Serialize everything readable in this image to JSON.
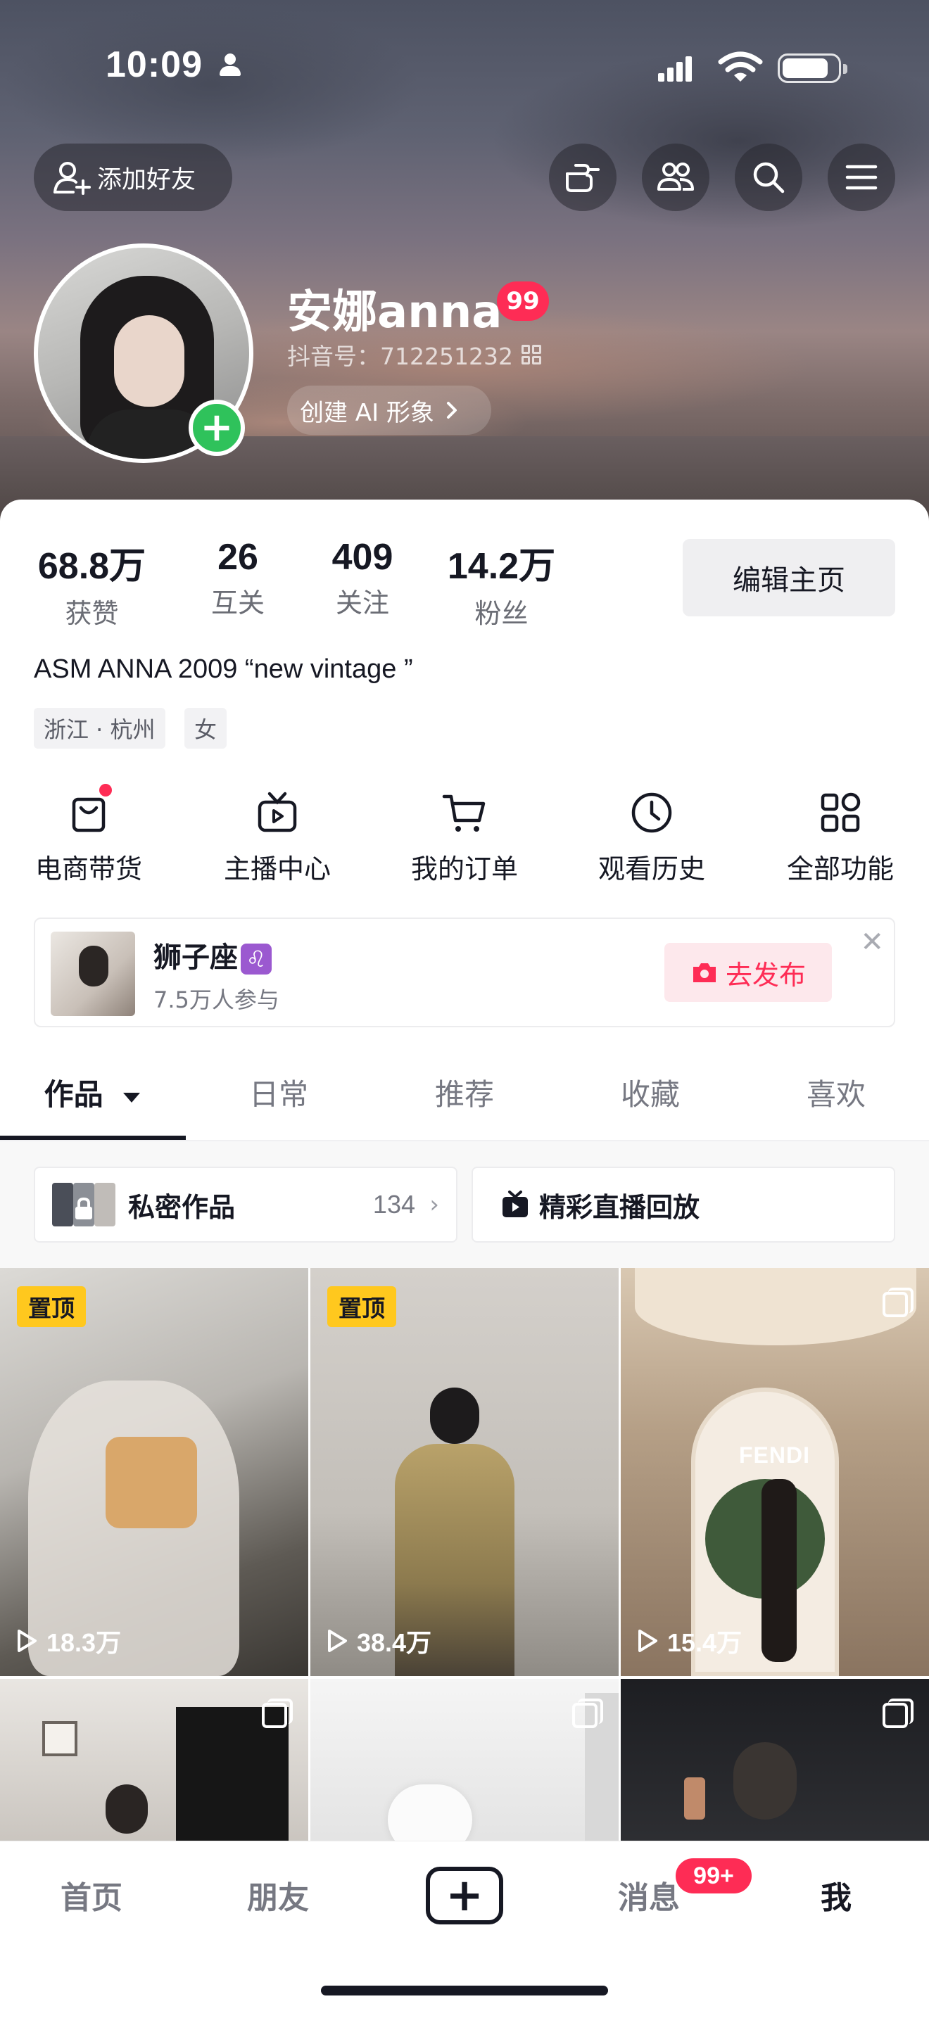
{
  "status_bar": {
    "time": "10:09"
  },
  "header": {
    "add_friend_label": "添加好友",
    "icons": [
      "poke-icon",
      "friends-icon",
      "search-icon",
      "menu-icon"
    ]
  },
  "profile": {
    "name": "安娜anna",
    "name_badge": "99",
    "douyin_id": "抖音号：712251232",
    "ai_button": "创建 AI 形象",
    "stats": [
      {
        "value": "68.8万",
        "label": "获赞"
      },
      {
        "value": "26",
        "label": "互关"
      },
      {
        "value": "409",
        "label": "关注"
      },
      {
        "value": "14.2万",
        "label": "粉丝"
      }
    ],
    "edit_button": "编辑主页",
    "bio": "ASM ANNA 2009 “new vintage ”",
    "tags": [
      "浙江 · 杭州",
      "女"
    ]
  },
  "functions": [
    {
      "label": "电商带货",
      "icon": "shopping-bag-icon",
      "has_dot": true
    },
    {
      "label": "主播中心",
      "icon": "tv-play-icon"
    },
    {
      "label": "我的订单",
      "icon": "cart-icon"
    },
    {
      "label": "观看历史",
      "icon": "clock-icon"
    },
    {
      "label": "全部功能",
      "icon": "grid-apps-icon"
    }
  ],
  "topic_card": {
    "title": "狮子座",
    "zodiac_glyph": "♌",
    "participants": "7.5万人参与",
    "publish_label": "去发布"
  },
  "tabs": [
    {
      "label": "作品",
      "active": true
    },
    {
      "label": "日常"
    },
    {
      "label": "推荐"
    },
    {
      "label": "收藏"
    },
    {
      "label": "喜欢"
    }
  ],
  "sub_buttons": {
    "private_label": "私密作品",
    "private_count": "134",
    "replay_label": "精彩直播回放"
  },
  "videos": [
    {
      "pinned": true,
      "pin_label": "置顶",
      "plays": "18.3万"
    },
    {
      "pinned": true,
      "pin_label": "置顶",
      "plays": "38.4万"
    },
    {
      "multi": true,
      "plays": "15.4万",
      "overlay_text": "FENDI"
    },
    {
      "multi": true
    },
    {
      "multi": true
    },
    {
      "multi": true
    }
  ],
  "bottom_nav": {
    "items": [
      "首页",
      "朋友",
      "消息",
      "我"
    ],
    "message_badge": "99+"
  },
  "colors": {
    "accent": "#fe2c55",
    "pin": "#ffc81e",
    "add_badge": "#2fc25b",
    "text": "#161823"
  }
}
